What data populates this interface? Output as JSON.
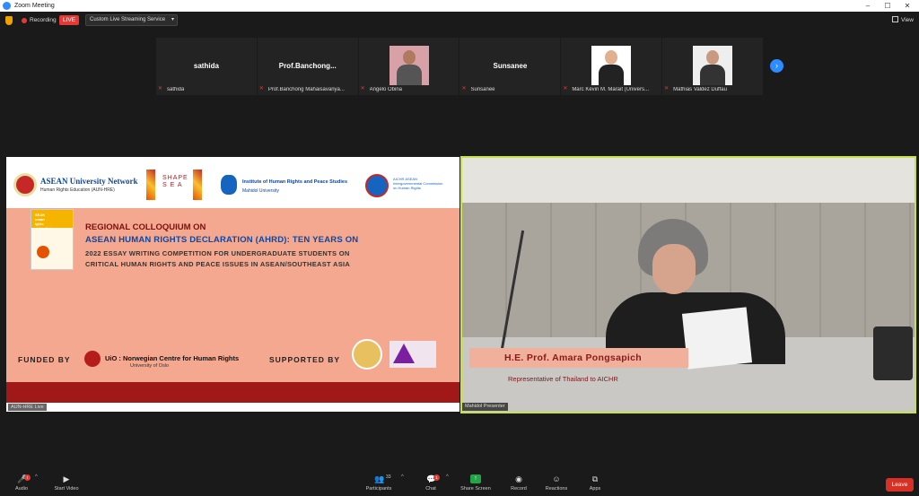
{
  "window": {
    "title": "Zoom Meeting",
    "minimize": "–",
    "maximize": "☐",
    "close": "✕"
  },
  "topbar": {
    "recording_label": "Recording",
    "live_label": "LIVE",
    "stream_service": "Custom Live Streaming Service",
    "view_label": "View"
  },
  "participants": [
    {
      "big_name": "sathida",
      "name": "sathida",
      "has_video": false
    },
    {
      "big_name": "Prof.Banchong...",
      "name": "Prof.Banchong Mahaisavariya...",
      "has_video": false
    },
    {
      "big_name": "",
      "name": "Angelo Obina",
      "has_video": true
    },
    {
      "big_name": "Sunsanee",
      "name": "Sunsanee",
      "has_video": false
    },
    {
      "big_name": "",
      "name": "Marc Kevin M. Marait (Univers...",
      "has_video": true
    },
    {
      "big_name": "",
      "name": "Mathias Valdez Duffau",
      "has_video": true
    }
  ],
  "slide": {
    "asean_network": "ASEAN University Network",
    "asean_network_sub": "Human Rights Education (AUN-HRE)",
    "shape_sea": "SHAPE\nS E A",
    "institute": "Institute of Human Rights and Peace Studies",
    "institute_sub": "Mahidol University",
    "aichr": "AICHR  ASEAN Intergovernmental Commission on Human Rights",
    "book_title": "SEAN\numan\nights\neclaration",
    "title1": "REGIONAL COLLOQUIUM ON",
    "title2": "ASEAN HUMAN RIGHTS DECLARATION (AHRD): TEN YEARS ON",
    "sub1": "2022 ESSAY WRITING COMPETITION FOR UNDERGRADUATE STUDENTS ON",
    "sub2": "CRITICAL HUMAN RIGHTS AND PEACE ISSUES IN ASEAN/SOUTHEAST ASIA",
    "funded_by": "FUNDED BY",
    "uio": "UiO : Norwegian Centre for Human Rights",
    "uio_sub": "University of Oslo",
    "supported_by": "SUPPORTED BY",
    "label": "AUN-HRE Live"
  },
  "speaker": {
    "name": "H.E. Prof. Amara Pongsapich",
    "role": "Representative of Thailand to AICHR",
    "label": "Mahidol Presenter"
  },
  "toolbar": {
    "audio": "Audio",
    "start_video": "Start Video",
    "participants": "Participants",
    "participants_count": "33",
    "chat": "Chat",
    "chat_badge": "1",
    "share_screen": "Share Screen",
    "record": "Record",
    "reactions": "Reactions",
    "apps": "Apps",
    "leave": "Leave"
  },
  "colors": {
    "accent": "#2d8cff",
    "live": "#e53935",
    "share": "#23a446",
    "leave": "#d93025",
    "active_border": "#c8e04a"
  }
}
